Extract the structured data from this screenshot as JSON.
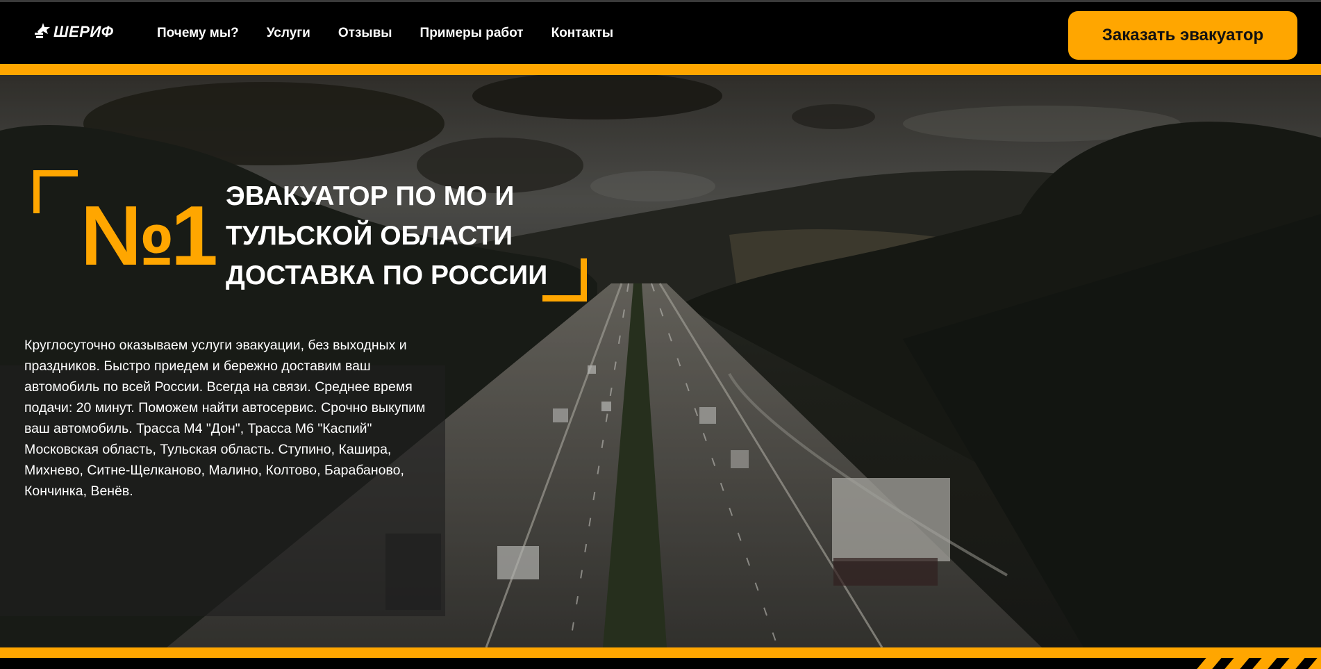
{
  "brand": {
    "name": "ШЕРИФ",
    "logo_icon": "sheriff-logo-icon",
    "accent_color": "#ffa600"
  },
  "nav": {
    "items": [
      {
        "label": "Почему мы?"
      },
      {
        "label": "Услуги"
      },
      {
        "label": "Отзывы"
      },
      {
        "label": "Примеры работ"
      },
      {
        "label": "Контакты"
      }
    ]
  },
  "header": {
    "cta_label": "Заказать эвакуатор"
  },
  "hero": {
    "number": "№1",
    "headline": [
      "ЭВАКУАТОР ПО МО И",
      "ТУЛЬСКОЙ ОБЛАСТИ",
      "ДОСТАВКА ПО РОССИИ"
    ],
    "description": "Круглосуточно оказываем услуги эвакуации, без выходных и праздников. Быстро приедем и бережно доставим ваш автомобиль по всей России. Всегда на связи. Среднее время подачи: 20 минут. Поможем найти автосервис. Срочно выкупим ваш автомобиль. Трасса М4 \"Дон\", Трасса М6 \"Каспий\" Московская область, Тульская область. Ступино, Кашира, Михнево, Ситне-Щелканово, Малино, Колтово, Барабаново, Кончинка, Венёв.",
    "background": "highway-landscape-photo"
  }
}
